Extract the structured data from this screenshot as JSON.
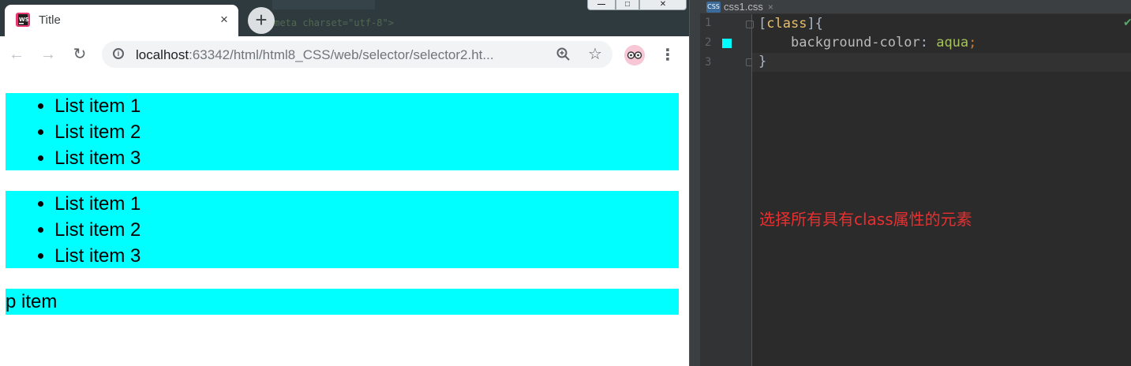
{
  "browser": {
    "tab": {
      "title": "Title",
      "close_glyph": "×"
    },
    "new_tab_glyph": "+",
    "window_controls": {
      "minimize": "—",
      "maximize": "□",
      "close": "✕"
    },
    "toolbar": {
      "back_glyph": "←",
      "forward_glyph": "→",
      "reload_glyph": "↻",
      "url_host": "localhost",
      "url_rest": ":63342/html/html8_CSS/web/selector/selector2.ht...",
      "menu_glyph": "⋮"
    },
    "icons": {
      "favicon": "webstorm-icon",
      "info": "info-icon",
      "zoom": "zoom-icon",
      "star": "bookmark-star-icon",
      "extension": "extension-glasses-icon",
      "menu": "more-menu-icon"
    }
  },
  "page": {
    "background_color": "#00ffff",
    "list1": [
      "List item 1",
      "List item 2",
      "List item 3"
    ],
    "list2": [
      "List item 1",
      "List item 2",
      "List item 3"
    ],
    "paragraph": "p item"
  },
  "editor": {
    "file_tab": "css1.css",
    "file_icon_label": "CSS",
    "line_numbers": [
      "1",
      "2",
      "3"
    ],
    "code": {
      "line1_open_bracket": "[",
      "line1_selector": "class",
      "line1_close": "]{",
      "line2_property": "background-color",
      "line2_colon": ": ",
      "line2_value": "aqua",
      "line2_semicolon": ";",
      "line3": "}"
    },
    "annotation": "选择所有具有class属性的元素",
    "annotation_color": "#e83030"
  }
}
